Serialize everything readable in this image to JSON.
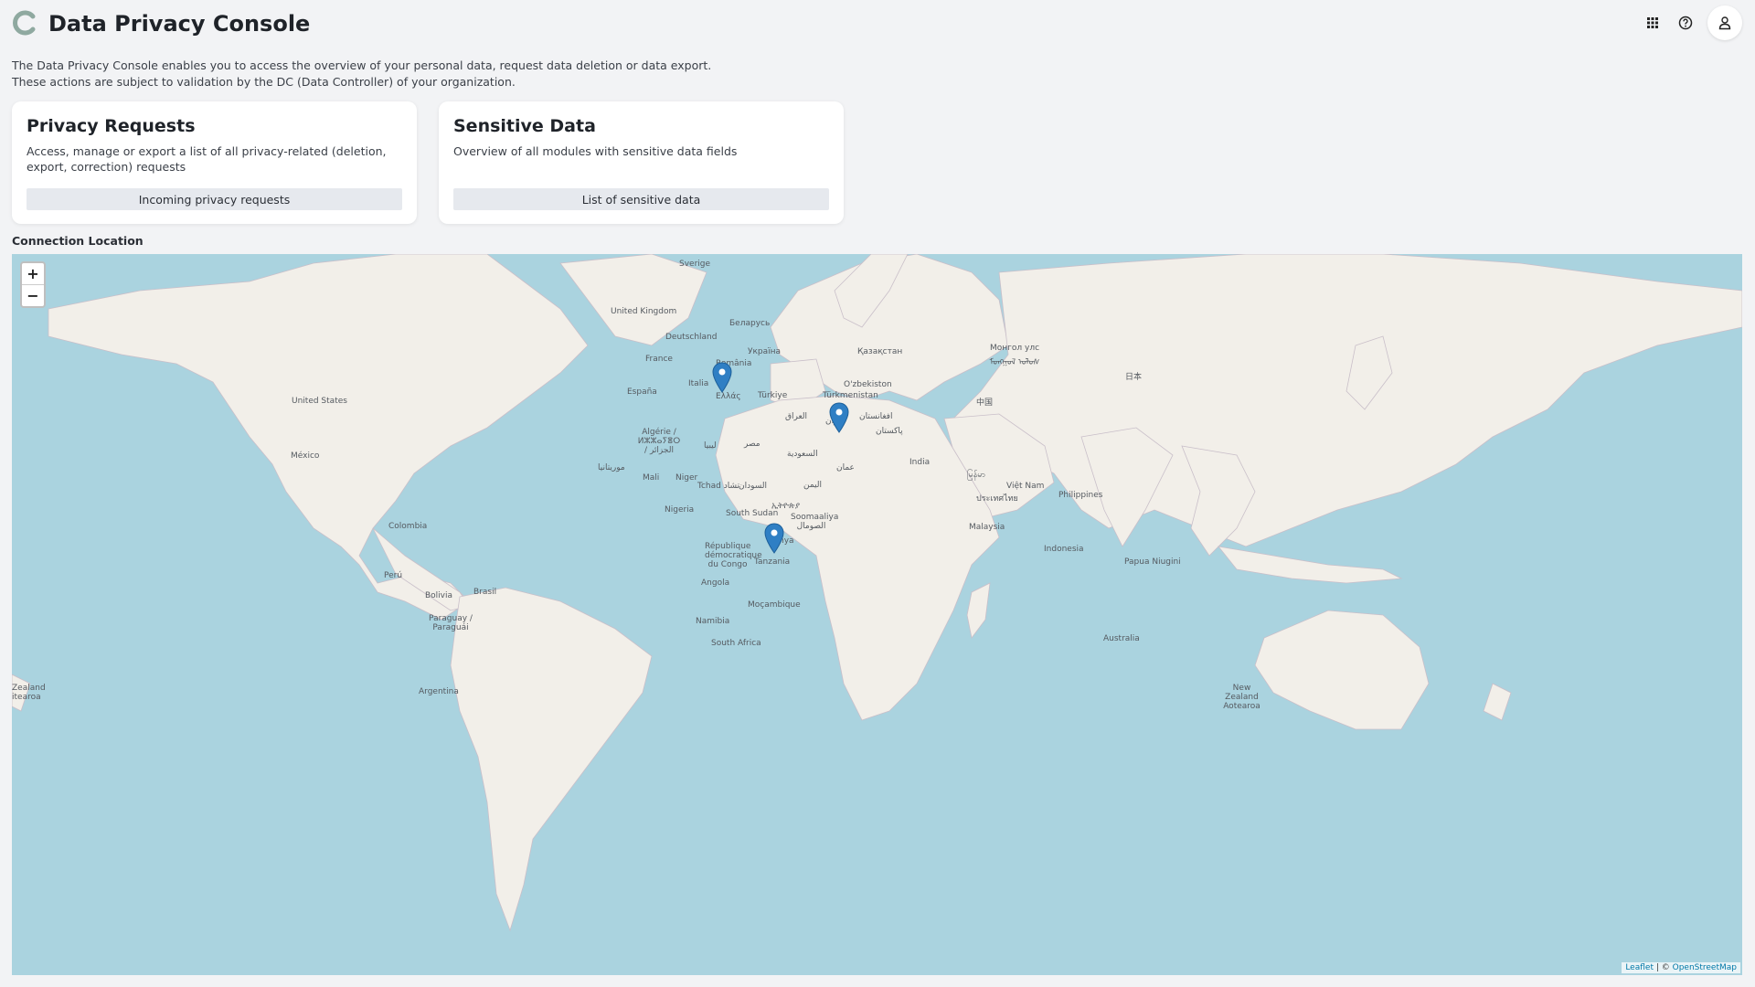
{
  "header": {
    "title": "Data Privacy Console",
    "icons": [
      "apps-grid-icon",
      "help-icon",
      "user-icon"
    ]
  },
  "intro": {
    "line1": "The Data Privacy Console enables you to access the overview of your personal data, request data deletion or data export.",
    "line2": "These actions are subject to validation by the DC (Data Controller) of your organization."
  },
  "cards": [
    {
      "title": "Privacy Requests",
      "description": "Access, manage or export a list of all privacy-related (deletion, export, correction) requests",
      "button": "Incoming privacy requests"
    },
    {
      "title": "Sensitive Data",
      "description": "Overview of all modules with sensitive data fields",
      "button": "List of sensitive data"
    }
  ],
  "map": {
    "label": "Connection Location",
    "zoom_in": "+",
    "zoom_out": "−",
    "attribution_leaflet": "Leaflet",
    "attribution_sep": " | © ",
    "attribution_osm": "OpenStreetMap",
    "place_labels": {
      "sverige": "Sverige",
      "uk": "United Kingdom",
      "belarus": "Беларусь",
      "deutschland": "Deutschland",
      "ukraina": "Україна",
      "kazakhstan": "Қазақстан",
      "mongolia": "Монгол улс ᠮᠣᠩᠭᠣᠯ ᠤᠯᠤᠰ",
      "france": "France",
      "romania": "România",
      "uzbekistan": "O'zbekiston",
      "espana": "España",
      "italia": "Italia",
      "turkiye": "Türkiye",
      "turkmenistan": "Türkmenistan",
      "ellas": "Ελλάς",
      "nippon": "日本",
      "china": "中国",
      "united_states": "United States",
      "iran": "ایران",
      "afghanistan": "افغانستان",
      "pakistan": "پاکستان",
      "algerie": "Algérie / ⵍⵣⵣⴰⵢⴻⵔ / الجزائر",
      "libya": "ليبيا",
      "misr": "مصر",
      "iraq": "العراق",
      "saudi": "السعودية",
      "mexico": "México",
      "mauritania": "موريتانيا",
      "india": "India",
      "mali": "Mali",
      "niger": "Niger",
      "oman": "عمان",
      "tchad": "Tchad تشاد",
      "sudan": "السودان",
      "yemen": "اليمن",
      "myanmar": "မြန်မာ",
      "vietnam": "Việt Nam",
      "thailand": "ประเทศไทย",
      "philippines": "Philippines",
      "ethiopia": "ኢትዮጵያ",
      "nigeria": "Nigeria",
      "south_sudan": "South Sudan",
      "somalia": "Soomaaliya الصومال",
      "colombia": "Colombia",
      "malaysia": "Malaysia",
      "kenya": "Kenya",
      "rdc": "République démocratique du Congo",
      "indonesia": "Indonesia",
      "tanzania": "Tanzania",
      "papua": "Papua Niugini",
      "peru": "Perú",
      "angola": "Angola",
      "brasil": "Brasil",
      "bolivia": "Bolivia",
      "mocambique": "Moçambique",
      "namibia": "Namibia",
      "paraguay": "Paraguay / Paraguái",
      "australia": "Australia",
      "south_africa": "South Africa",
      "argentina": "Argentina",
      "nz_right": "New Zealand Aotearoa",
      "nz_left": "Zealand itearoa"
    },
    "colors": {
      "water": "#aad3df",
      "land": "#f2efe9",
      "border": "#b9a9bd",
      "marker": "#2f7fc4"
    }
  }
}
